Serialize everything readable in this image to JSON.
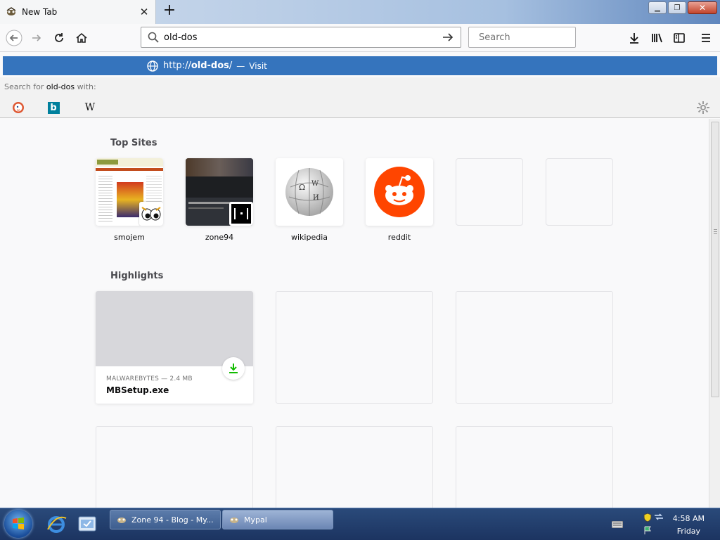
{
  "tab": {
    "title": "New Tab"
  },
  "window": {
    "minimize_glyph": "▁",
    "maximize_glyph": "❐",
    "close_glyph": "✕"
  },
  "urlbar": {
    "value": "old-dos"
  },
  "searchbar": {
    "placeholder": "Search"
  },
  "suggestion": {
    "prefix": "http://",
    "host": "old-dos",
    "suffix": "/",
    "dash": "—",
    "action": "Visit"
  },
  "search_for": {
    "prefix": "Search for",
    "term": "old-dos",
    "suffix": "with:"
  },
  "engines": [
    {
      "name": "DuckDuckGo",
      "icon": "duckduckgo-icon"
    },
    {
      "name": "Bing",
      "icon": "bing-icon",
      "glyph": "b"
    },
    {
      "name": "Wikipedia",
      "icon": "wikipedia-icon",
      "glyph": "W"
    }
  ],
  "top_sites": {
    "title": "Top Sites",
    "items": [
      {
        "label": "smojem"
      },
      {
        "label": "zone94"
      },
      {
        "label": "wikipedia"
      },
      {
        "label": "reddit"
      }
    ]
  },
  "highlights": {
    "title": "Highlights",
    "download": {
      "meta": "MALWAREBYTES — 2.4 MB",
      "filename": "MBSetup.exe"
    }
  },
  "taskbar": {
    "items": [
      {
        "label": "Zone 94 - Blog - My..."
      },
      {
        "label": "Mypal"
      }
    ],
    "clock": {
      "time": "4:58 AM",
      "day": "Friday"
    }
  },
  "colors": {
    "accent": "#3574bd",
    "reddit": "#ff4500",
    "download": "#12bc00"
  }
}
